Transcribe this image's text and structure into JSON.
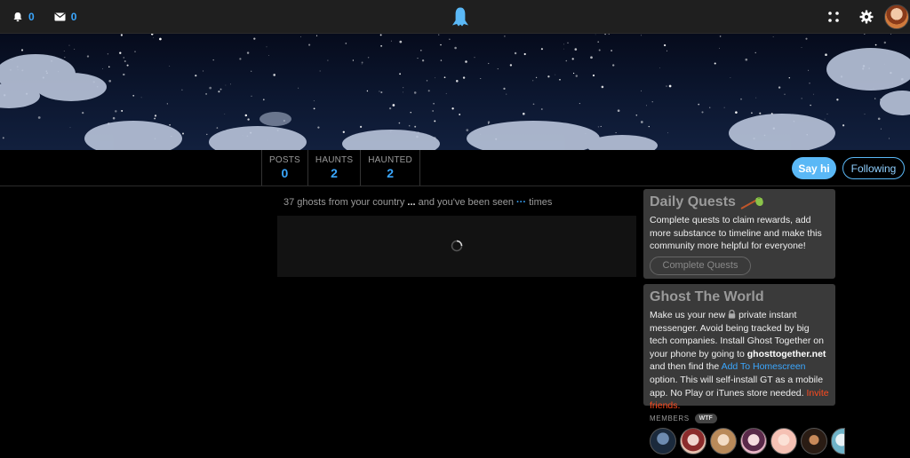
{
  "topbar": {
    "notifications_count": "0",
    "messages_count": "0",
    "icons": [
      "bell-icon",
      "envelope-icon",
      "ghost-logo-icon",
      "grid-icon",
      "gear-icon"
    ],
    "accent_color": "#3aa7ff"
  },
  "profile": {
    "stats": [
      {
        "label": "POSTS",
        "value": "0"
      },
      {
        "label": "HAUNTS",
        "value": "2"
      },
      {
        "label": "HAUNTED",
        "value": "2"
      }
    ],
    "say_hi_label": "Say hi",
    "following_label": "Following"
  },
  "feed": {
    "visits_prefix": "37 ghosts from your country",
    "visits_ellipsis": "...",
    "visits_middle": "and you've been seen",
    "visits_dots": "···",
    "visits_suffix": "times"
  },
  "quests": {
    "title": "Daily Quests",
    "text": "Complete quests to claim rewards, add more substance to timeline and make this community more helpful for everyone!",
    "button": "Complete Quests"
  },
  "ghost_world": {
    "title": "Ghost The World",
    "t1": "Make us your new",
    "t2": "private instant messenger. Avoid being tracked by big tech companies. Install Ghost Together on your phone by going to",
    "site": "ghosttogether.net",
    "t3": "and then find the",
    "link": "Add To Homescreen",
    "t4": "option. This will self-install GT as a mobile app. No Play or iTunes store needed.",
    "invite": "Invite friends."
  },
  "members": {
    "label": "MEMBERS",
    "badge": "WTF"
  }
}
